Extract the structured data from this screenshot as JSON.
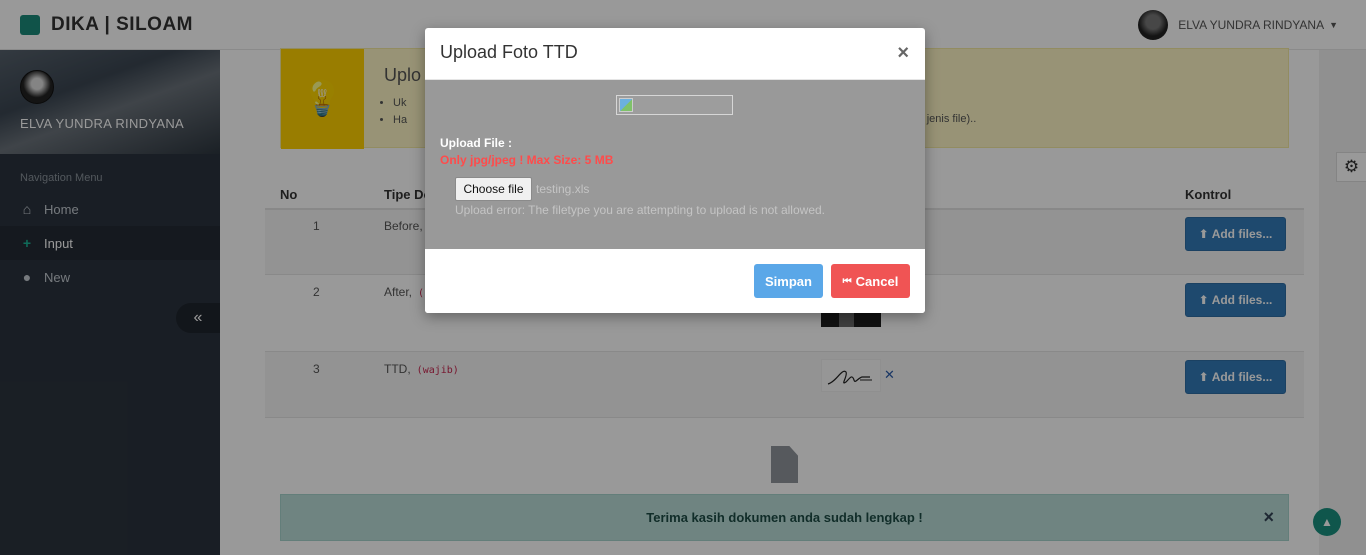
{
  "app": {
    "brand": "DIKA | SILOAM"
  },
  "user": {
    "name": "ELVA YUNDRA RINDYANA"
  },
  "sidebar": {
    "profile_name": "ELVA YUNDRA RINDYANA",
    "nav_title": "Navigation Menu",
    "items": [
      {
        "label": "Home",
        "icon": "home-icon"
      },
      {
        "label": "Input",
        "icon": "plus-icon"
      },
      {
        "label": "New",
        "icon": "user-icon"
      }
    ]
  },
  "info": {
    "title": "Uplo",
    "items": [
      "Uk",
      "Ha"
    ],
    "tail": "tas jenis file).."
  },
  "table": {
    "headers": [
      "No",
      "Tipe Do",
      "Kontrol"
    ],
    "rows": [
      {
        "no": "1",
        "type": "Before,",
        "tag": "",
        "button": "Add files..."
      },
      {
        "no": "2",
        "type": "After,",
        "tag": "(",
        "button": "Add files..."
      },
      {
        "no": "3",
        "type": "TTD,",
        "tag": "(wajib)",
        "button": "Add files..."
      }
    ]
  },
  "alert": {
    "message": "Terima kasih dokumen anda sudah lengkap !",
    "close": "×"
  },
  "modal": {
    "title": "Upload Foto TTD",
    "close": "×",
    "upload_label": "Upload File :",
    "upload_hint": "Only jpg/jpeg ! Max Size: 5 MB",
    "choose_file": "Choose file",
    "file_name": "testing.xls",
    "error": "Upload error: The filetype you are attempting to upload is not allowed.",
    "save": "Simpan",
    "cancel": "Cancel"
  },
  "colors": {
    "primary": "#337ab7",
    "danger": "#f05454",
    "info": "#5aa7e8",
    "brand": "#1c8a7a"
  }
}
